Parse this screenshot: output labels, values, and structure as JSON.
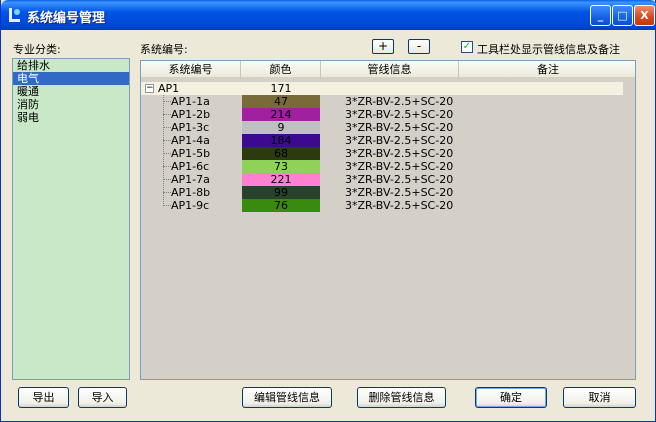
{
  "window": {
    "title": "系统编号管理"
  },
  "titlebar": {
    "min": "_",
    "max": "□",
    "close": "X"
  },
  "category": {
    "label": "专业分类:",
    "items": [
      "给排水",
      "电气",
      "暖通",
      "消防",
      "弱电"
    ],
    "selected": "电气"
  },
  "system": {
    "label": "系统编号:",
    "add": "+",
    "remove": "-",
    "checkbox_label": "工具栏处显示管线信息及备注",
    "checkbox_checked": true,
    "checkbox_mark": "✓"
  },
  "grid": {
    "headers": [
      "系统编号",
      "颜色",
      "管线信息",
      "备注"
    ],
    "parent": {
      "name": "AP1",
      "color_index": "171",
      "toggle": "−"
    },
    "rows": [
      {
        "name": "AP1-1a",
        "color_index": "47",
        "color": "#7a6a3a",
        "info": "3*ZR-BV-2.5+SC-20"
      },
      {
        "name": "AP1-2b",
        "color_index": "214",
        "color": "#a020a0",
        "info": "3*ZR-BV-2.5+SC-20"
      },
      {
        "name": "AP1-3c",
        "color_index": "9",
        "color": "#c0c0c0",
        "info": "3*ZR-BV-2.5+SC-20"
      },
      {
        "name": "AP1-4a",
        "color_index": "184",
        "color": "#3a0a90",
        "info": "3*ZR-BV-2.5+SC-20"
      },
      {
        "name": "AP1-5b",
        "color_index": "68",
        "color": "#2c3a10",
        "info": "3*ZR-BV-2.5+SC-20"
      },
      {
        "name": "AP1-6c",
        "color_index": "73",
        "color": "#8ed25a",
        "info": "3*ZR-BV-2.5+SC-20"
      },
      {
        "name": "AP1-7a",
        "color_index": "221",
        "color": "#ff7fd0",
        "info": "3*ZR-BV-2.5+SC-20"
      },
      {
        "name": "AP1-8b",
        "color_index": "99",
        "color": "#28422c",
        "info": "3*ZR-BV-2.5+SC-20"
      },
      {
        "name": "AP1-9c",
        "color_index": "76",
        "color": "#3a8a10",
        "info": "3*ZR-BV-2.5+SC-20"
      }
    ]
  },
  "buttons": {
    "export": "导出",
    "import": "导入",
    "edit": "编辑管线信息",
    "delete": "删除管线信息",
    "ok": "确定",
    "cancel": "取消"
  }
}
